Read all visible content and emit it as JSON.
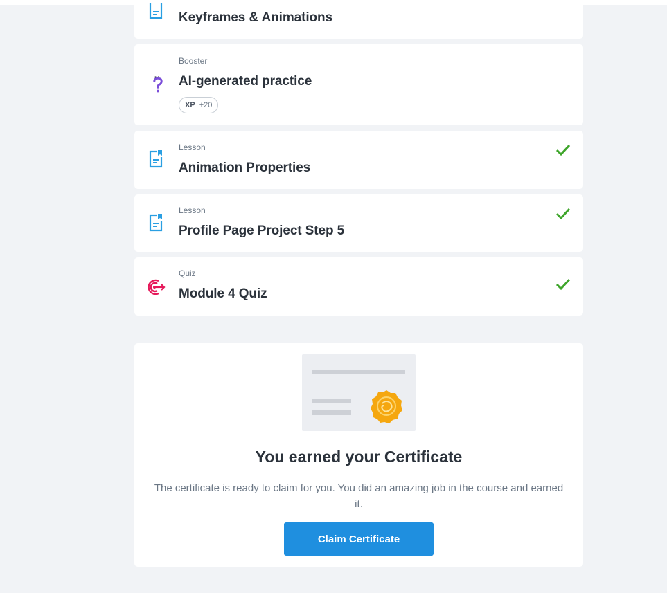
{
  "items": [
    {
      "type": "",
      "title": "Keyframes & Animations",
      "icon": "lesson-icon",
      "completed": false
    },
    {
      "type": "Booster",
      "title": "AI-generated practice",
      "icon": "question-mark-icon",
      "xp_label": "XP",
      "xp_value": "+20",
      "completed": false
    },
    {
      "type": "Lesson",
      "title": "Animation Properties",
      "icon": "lesson-icon",
      "completed": true
    },
    {
      "type": "Lesson",
      "title": "Profile Page Project Step 5",
      "icon": "lesson-icon",
      "completed": true
    },
    {
      "type": "Quiz",
      "title": "Module 4 Quiz",
      "icon": "target-icon",
      "completed": true
    }
  ],
  "certificate": {
    "title": "You earned your Certificate",
    "description": "The certificate is ready to claim for you. You did an amazing job in the course and earned it.",
    "button_label": "Claim Certificate"
  },
  "colors": {
    "background": "#f1f3f6",
    "card": "#ffffff",
    "lesson_icon": "#2a9fe2",
    "booster_icon": "#7b4ed9",
    "quiz_icon": "#e6195a",
    "check": "#3ea52a",
    "button": "#1f8fdf",
    "seal": "#f5a70f"
  }
}
